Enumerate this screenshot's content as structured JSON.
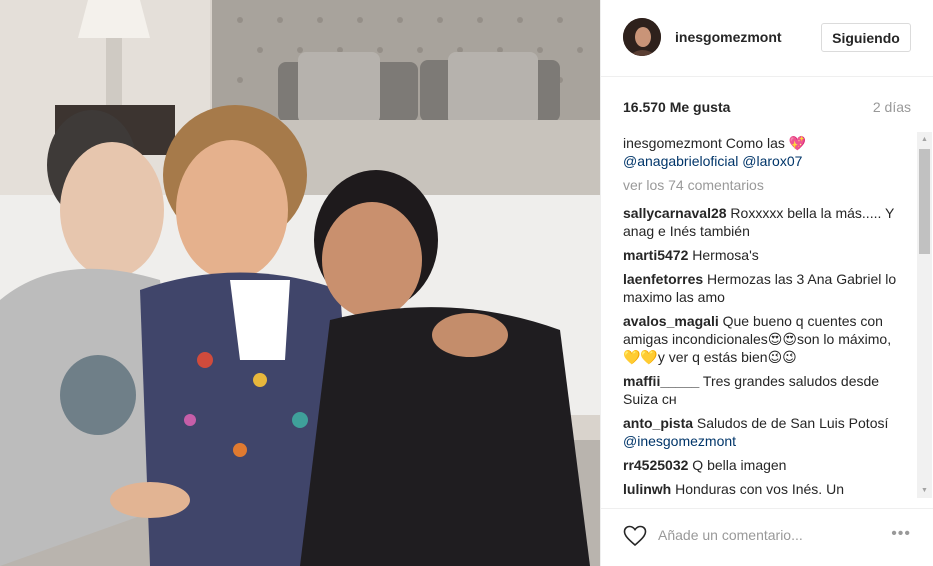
{
  "post": {
    "username": "inesgomezmont",
    "follow_label": "Siguiendo",
    "likes": "16.570 Me gusta",
    "time_ago": "2 días",
    "caption": {
      "user": "inesgomezmont",
      "text": "Como las",
      "emoji": "💖",
      "mention1": "@anagabrieloficial",
      "mention2": "@larox07"
    },
    "view_comments": "ver los 74 comentarios",
    "comments": [
      {
        "user": "sallycarnaval28",
        "text": "Roxxxxx bella la más..... Y anag e Inés también"
      },
      {
        "user": "marti5472",
        "text": "Hermosa's"
      },
      {
        "user": "laenfetorres",
        "text": "Hermozas las 3 Ana Gabriel lo maximo las amo"
      },
      {
        "user": "avalos_magali",
        "text": "Que bueno q cuentes con amigas incondicionales😍😍son lo máximo,💛💛y ver q estás bien😉😉"
      },
      {
        "user": "maffii_____",
        "text": "Tres grandes saludos desde Suiza ᴄʜ"
      },
      {
        "user": "anto_pista",
        "text": "Saludos de de San Luis Potosí",
        "mention": "@inesgomezmont"
      },
      {
        "user": "rr4525032",
        "text": "Q bella imagen"
      },
      {
        "user": "lulinwh",
        "text": "Honduras con vos Inés. Un"
      }
    ],
    "add_comment_placeholder": "Añade un comentario...",
    "more_options": "•••"
  },
  "icons": {
    "heart": "heart-outline-icon",
    "options": "ellipsis-icon",
    "scroll_up": "arrow-up-icon",
    "scroll_down": "arrow-down-icon"
  },
  "colors": {
    "link": "#003569",
    "muted": "#999999",
    "border": "#efefef"
  }
}
